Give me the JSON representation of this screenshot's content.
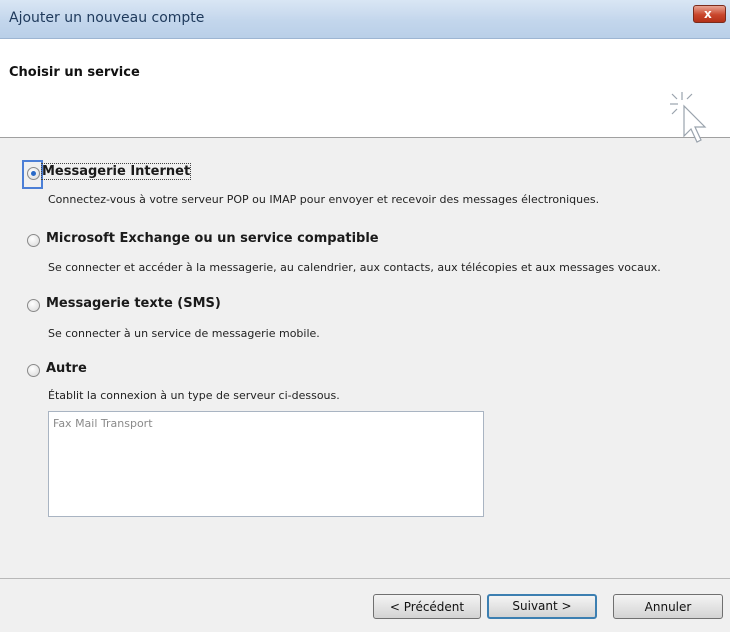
{
  "window": {
    "title": "Ajouter un nouveau compte",
    "close_label": "x"
  },
  "header": {
    "title": "Choisir un service"
  },
  "options": [
    {
      "label": "Messagerie Internet",
      "description": "Connectez-vous à votre serveur POP ou IMAP pour envoyer et recevoir des messages électroniques.",
      "selected": true
    },
    {
      "label": "Microsoft Exchange ou un service compatible",
      "description": "Se connecter et accéder à la messagerie, au calendrier, aux contacts, aux télécopies et aux messages vocaux.",
      "selected": false
    },
    {
      "label": "Messagerie texte (SMS)",
      "description": "Se connecter à un service de messagerie mobile.",
      "selected": false
    },
    {
      "label": "Autre",
      "description": "Établit la connexion à un type de serveur ci-dessous.",
      "selected": false
    }
  ],
  "other_list": {
    "items": [
      "Fax Mail Transport"
    ]
  },
  "buttons": {
    "previous": "< Précédent",
    "next": "Suivant >",
    "cancel": "Annuler"
  },
  "colors": {
    "title_text": "#1e395b",
    "focus_accent": "#4c7fd6",
    "close_button": "#c9462c"
  }
}
